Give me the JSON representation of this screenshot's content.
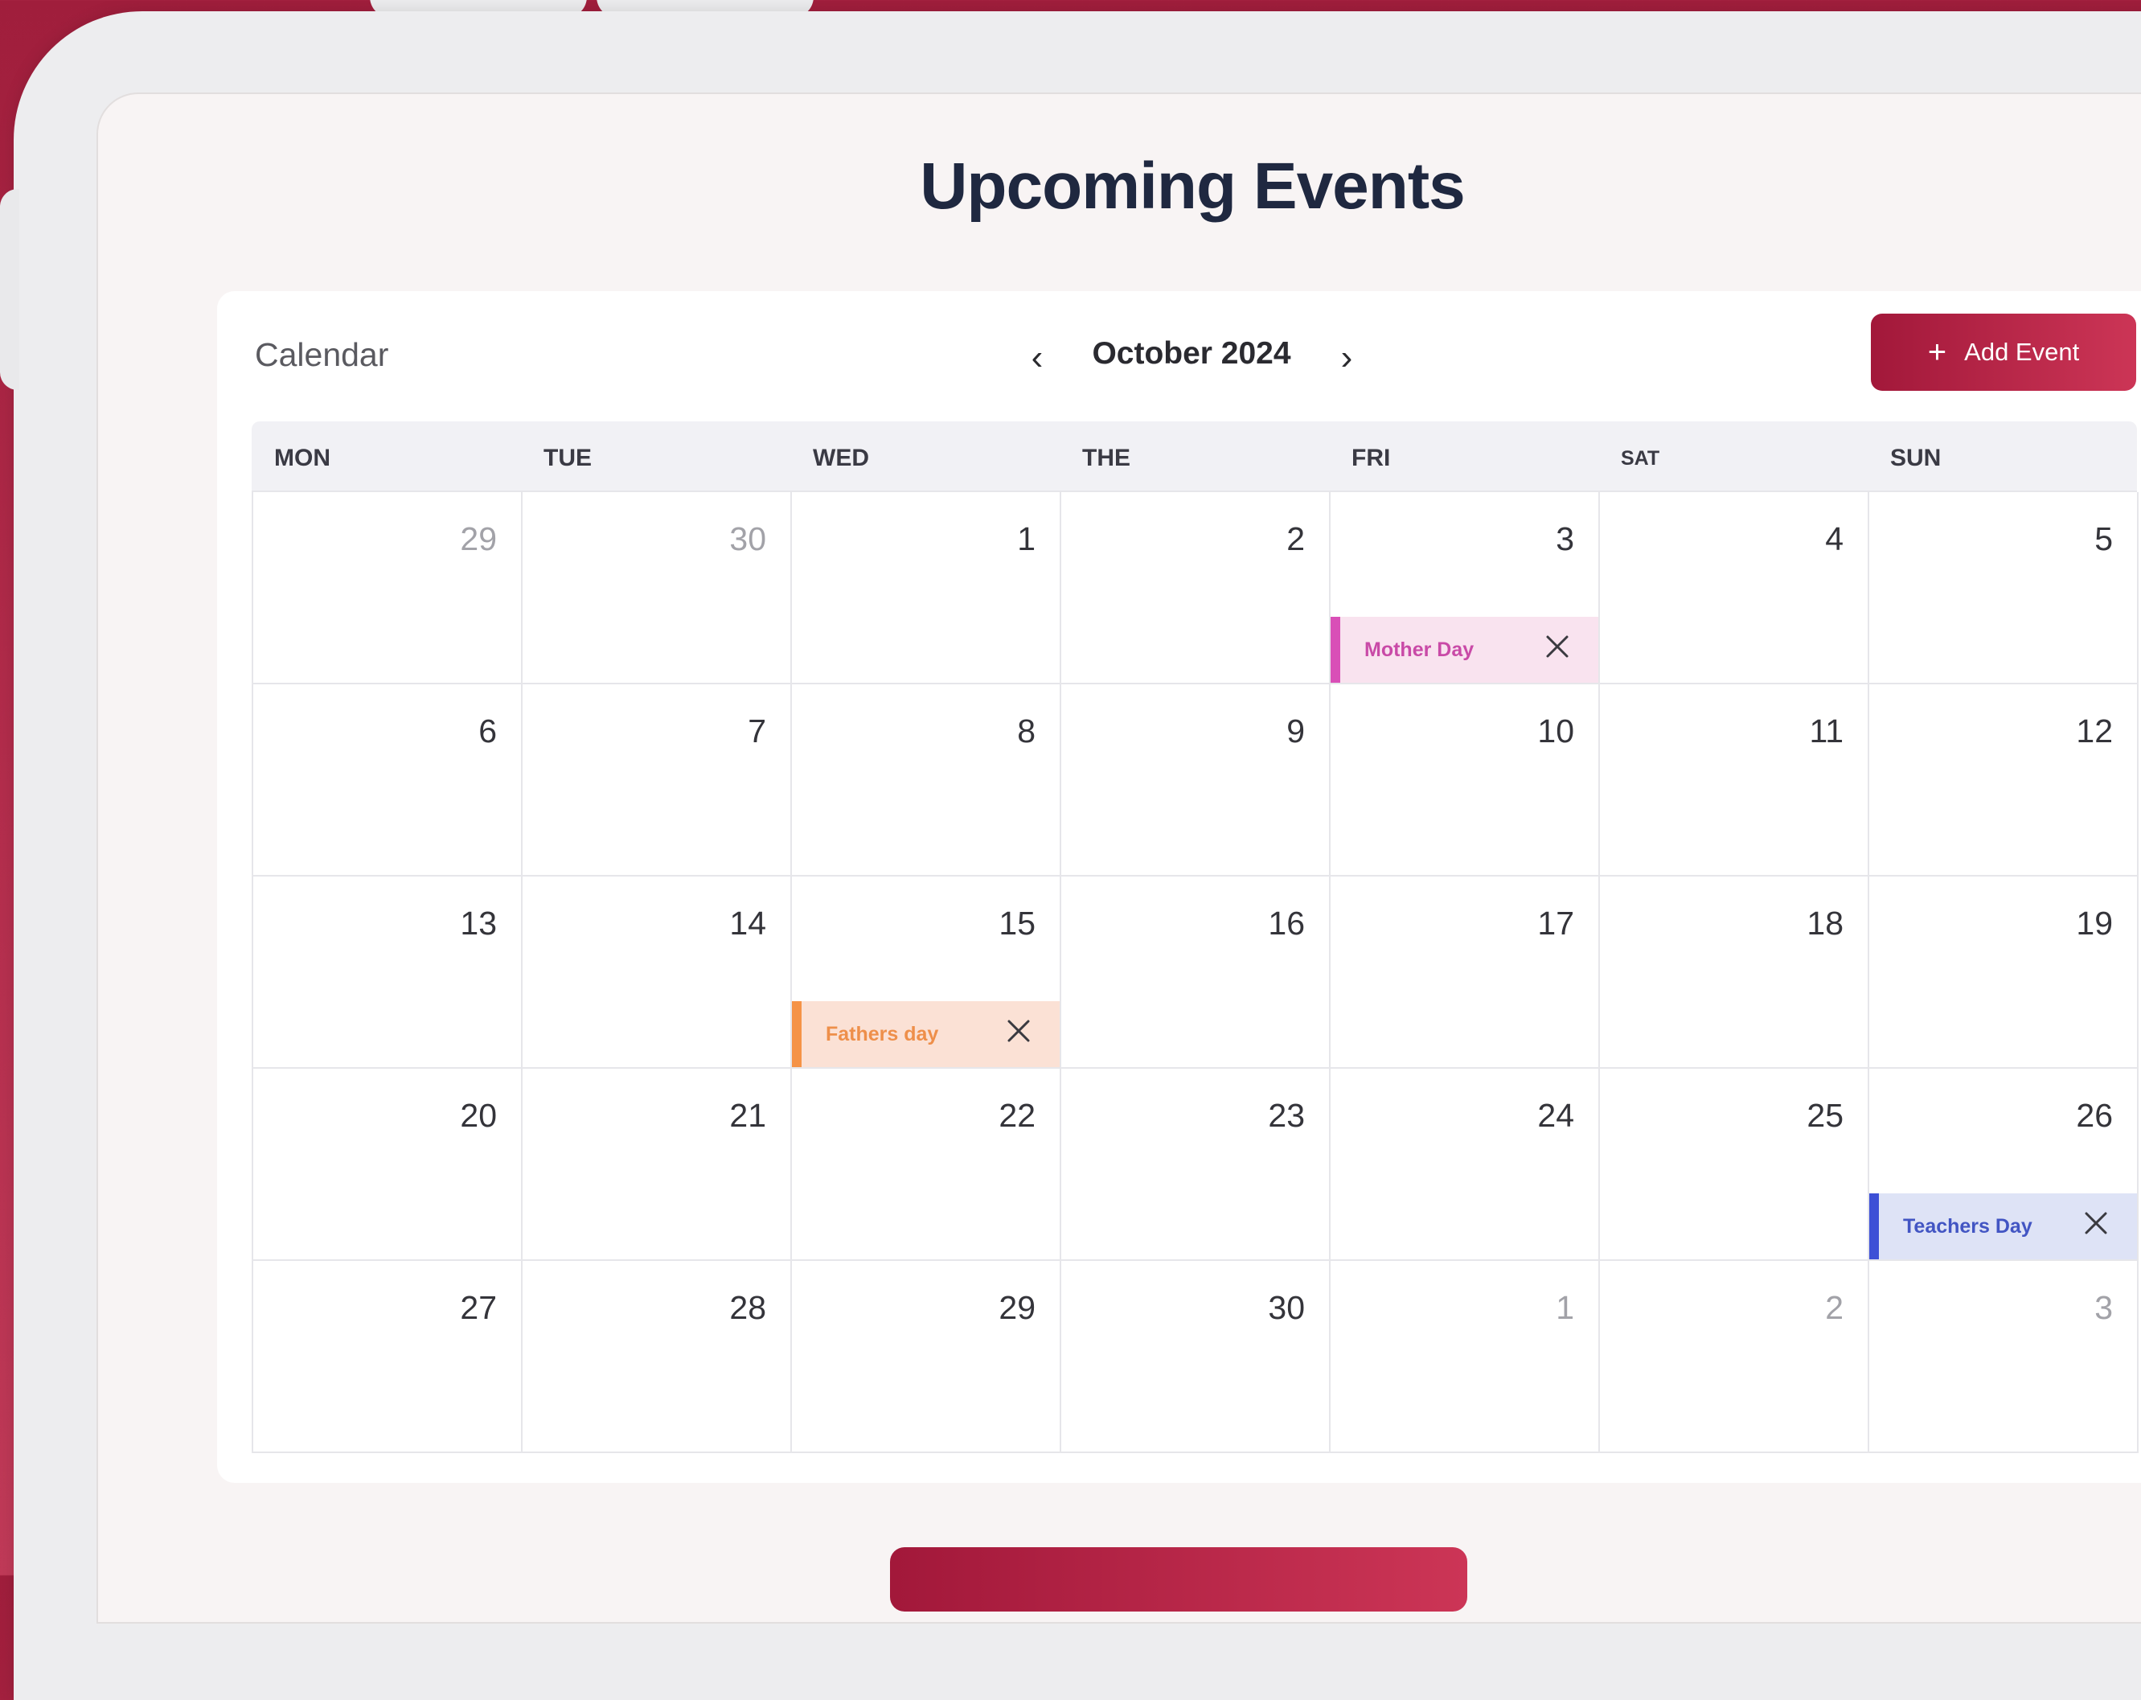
{
  "page": {
    "title": "Upcoming Events"
  },
  "calendar": {
    "label": "Calendar",
    "month": "October 2024",
    "prev_icon": "‹",
    "next_icon": "›",
    "add_button": {
      "icon": "+",
      "label": "Add Event"
    },
    "weekdays": [
      "MON",
      "TUE",
      "WED",
      "THE",
      "FRI",
      "SAT",
      "SUN"
    ],
    "weeks": [
      [
        {
          "day": "29",
          "muted": true
        },
        {
          "day": "30",
          "muted": true
        },
        {
          "day": "1"
        },
        {
          "day": "2"
        },
        {
          "day": "3",
          "event": {
            "title": "Mother Day",
            "color": "pink"
          }
        },
        {
          "day": "4"
        },
        {
          "day": "5"
        }
      ],
      [
        {
          "day": "6"
        },
        {
          "day": "7"
        },
        {
          "day": "8"
        },
        {
          "day": "9"
        },
        {
          "day": "10"
        },
        {
          "day": "11"
        },
        {
          "day": "12"
        }
      ],
      [
        {
          "day": "13"
        },
        {
          "day": "14"
        },
        {
          "day": "15",
          "event": {
            "title": "Fathers day",
            "color": "orange"
          }
        },
        {
          "day": "16"
        },
        {
          "day": "17"
        },
        {
          "day": "18"
        },
        {
          "day": "19"
        }
      ],
      [
        {
          "day": "20"
        },
        {
          "day": "21"
        },
        {
          "day": "22"
        },
        {
          "day": "23"
        },
        {
          "day": "24"
        },
        {
          "day": "25"
        },
        {
          "day": "26",
          "event": {
            "title": "Teachers Day",
            "color": "blue"
          }
        }
      ],
      [
        {
          "day": "27"
        },
        {
          "day": "28"
        },
        {
          "day": "29"
        },
        {
          "day": "30"
        },
        {
          "day": "1",
          "muted": true
        },
        {
          "day": "2",
          "muted": true
        },
        {
          "day": "3",
          "muted": true
        }
      ]
    ]
  },
  "colors": {
    "accent": "#a2183a",
    "event_pink": "#d94fb7",
    "event_orange": "#f59347",
    "event_blue": "#3d50d6"
  }
}
